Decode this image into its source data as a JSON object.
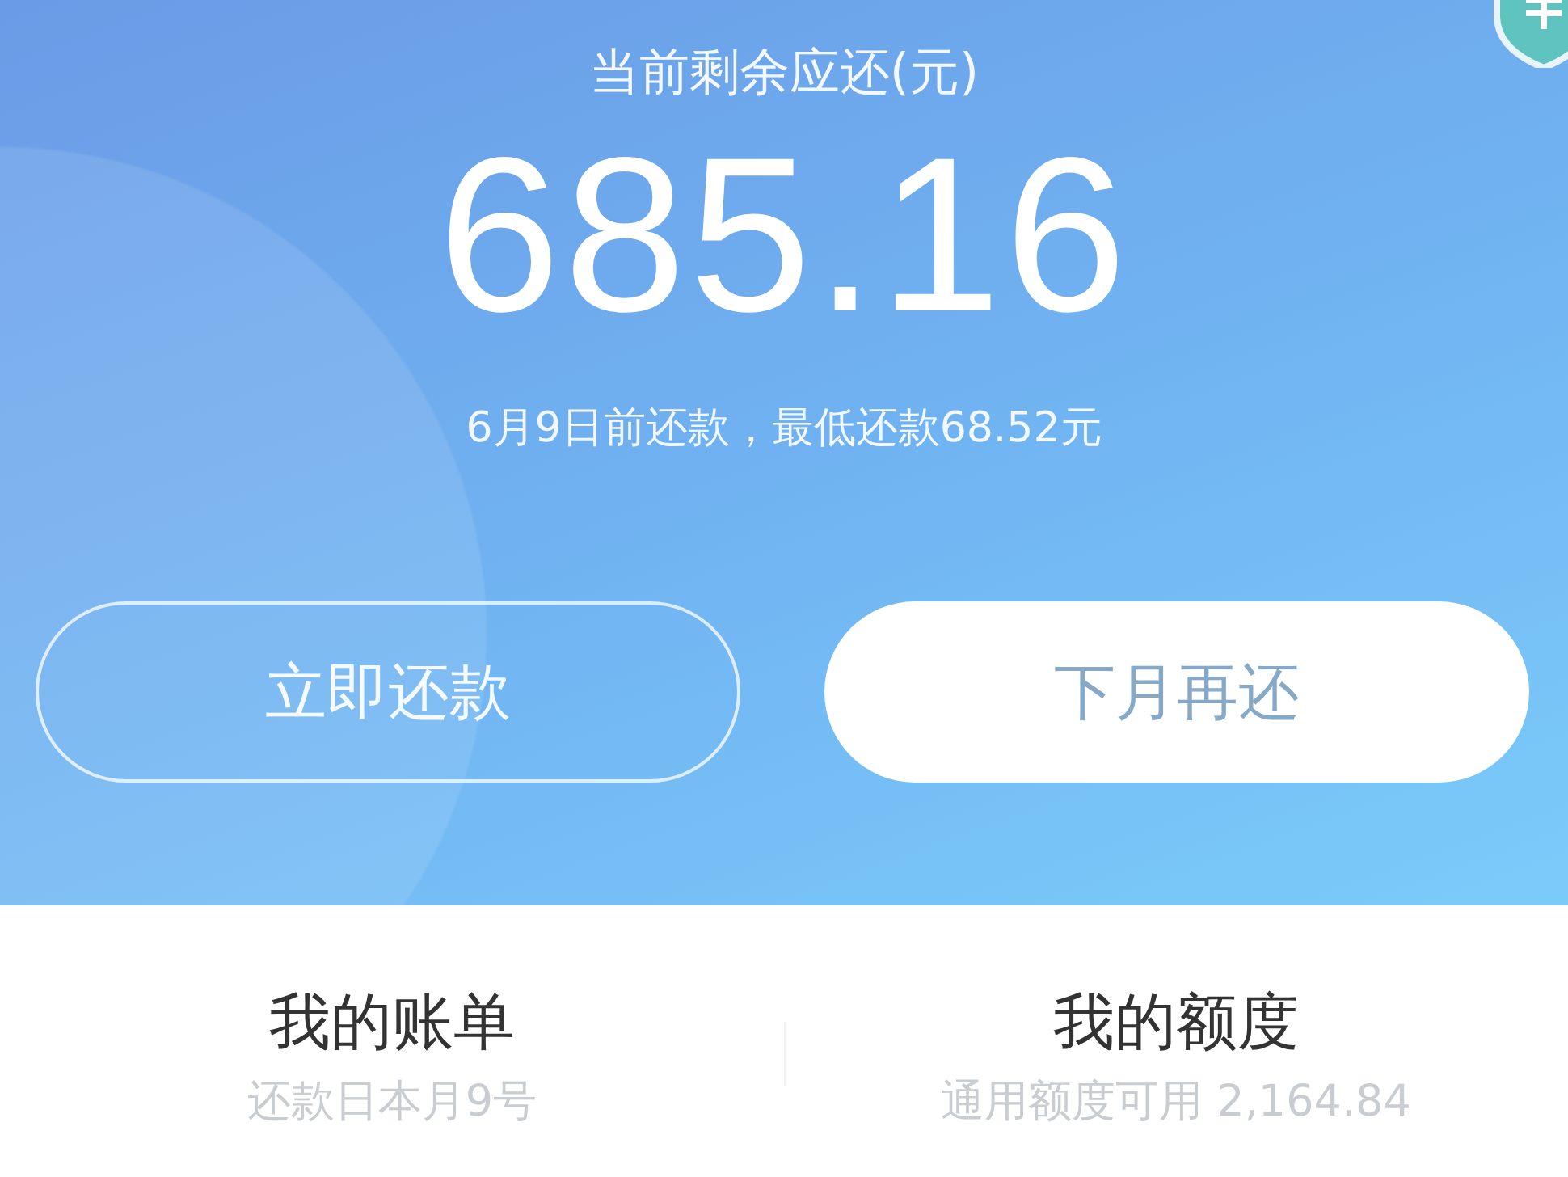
{
  "header": {
    "title": "当前剩余应还(元)",
    "amount": "685.16",
    "due_note": "6月9日前还款，最低还款68.52元"
  },
  "buttons": [
    {
      "label": "立即还款",
      "kind": "outline"
    },
    {
      "label": "下月再还",
      "kind": "filled"
    }
  ],
  "summary": [
    {
      "title": "我的账单",
      "subtitle": "还款日本月9号"
    },
    {
      "title": "我的额度",
      "subtitle": "通用额度可用 2,164.84"
    }
  ]
}
